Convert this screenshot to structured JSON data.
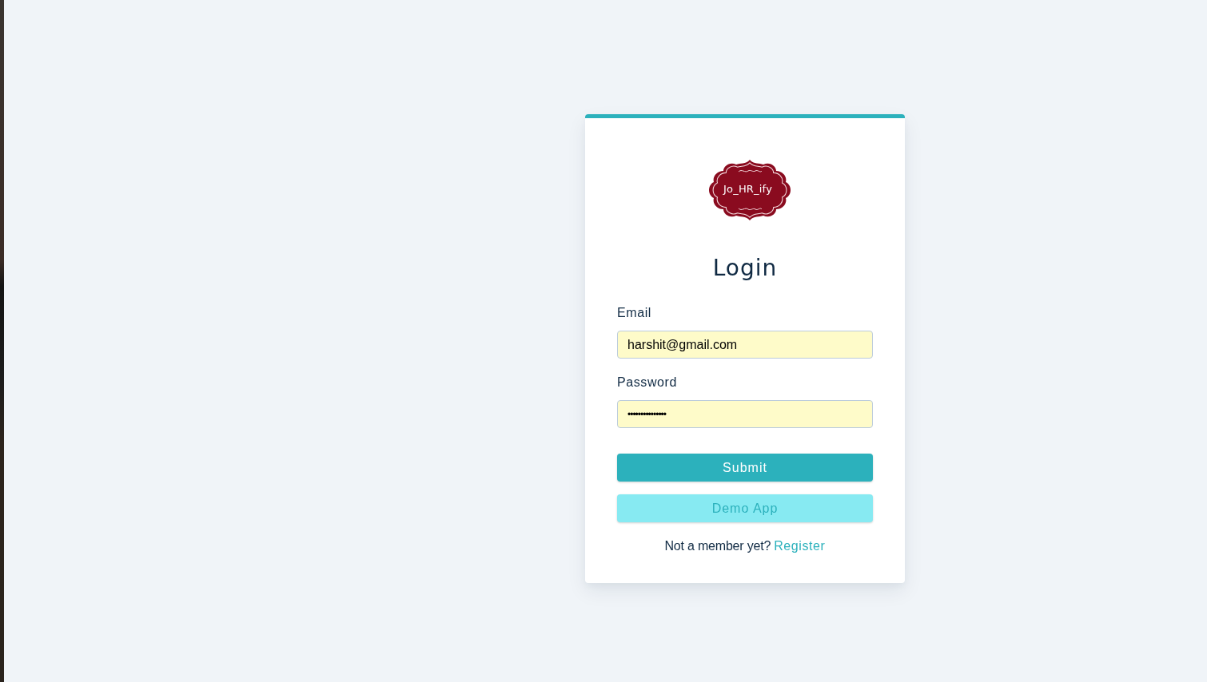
{
  "logo": {
    "text": "Jo_HR_ify"
  },
  "title": "Login",
  "fields": [
    {
      "label": "Email",
      "kind": "text",
      "value": "harshit@gmail.com",
      "autofilled": true
    },
    {
      "label": "Password",
      "kind": "password",
      "value": "•••••••••••••••",
      "autofilled": true
    }
  ],
  "buttons": [
    {
      "label": "Submit",
      "kind": "primary"
    },
    {
      "label": "Demo App",
      "kind": "secondary"
    }
  ],
  "footer": {
    "text": "Not a member yet?",
    "link": "Register"
  }
}
